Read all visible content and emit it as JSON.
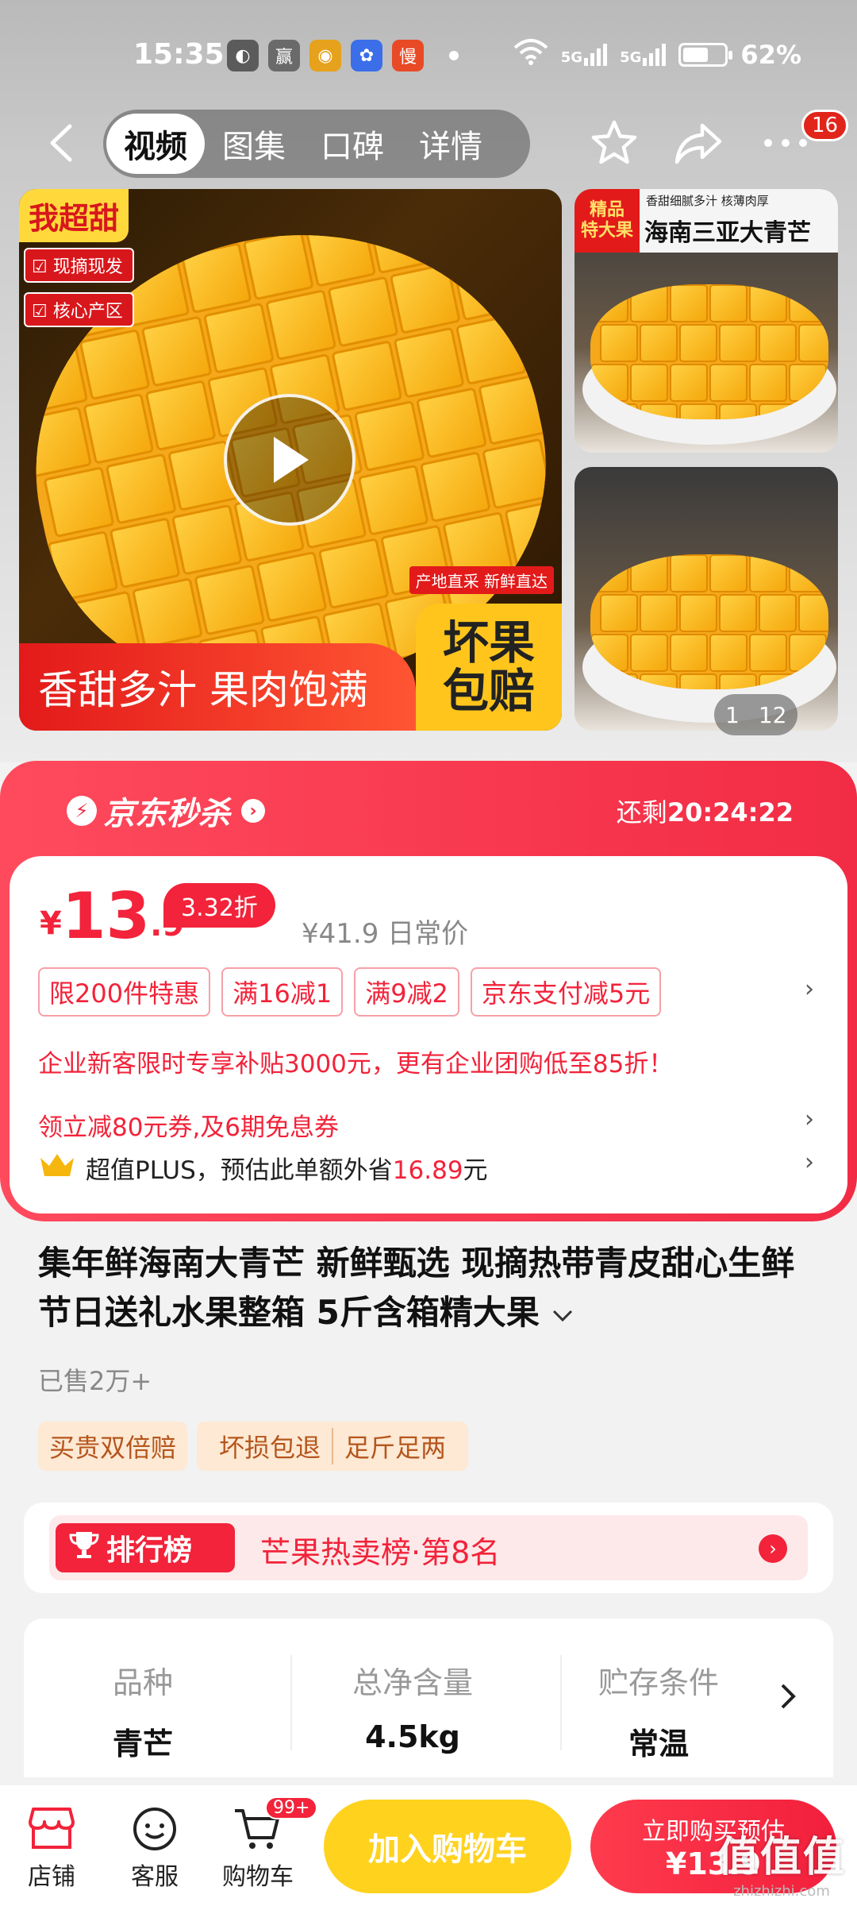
{
  "status": {
    "time": "15:35",
    "battery": "62%",
    "battery_level": 0.62,
    "net1": "5G",
    "net2": "5G"
  },
  "status_apps": [
    {
      "name": "wechat-icon",
      "glyph": "◐",
      "color": "#5b5b5b"
    },
    {
      "name": "realme-app-icon",
      "glyph": "赢",
      "color": "#6a6a6a"
    },
    {
      "name": "weibo-icon",
      "glyph": "◉",
      "color": "#e6a21c"
    },
    {
      "name": "baidu-icon",
      "glyph": "✿",
      "color": "#3b6ee8"
    },
    {
      "name": "slow-app-icon",
      "glyph": "慢",
      "color": "#e84a26"
    }
  ],
  "nav": {
    "tabs": [
      "视频",
      "图集",
      "口碑",
      "详情"
    ],
    "active_tab": 0,
    "more_badge": "16"
  },
  "media": {
    "main_tag": "我超甜",
    "chip1": "现摘现发",
    "chip2": "核心产区",
    "small_tag": "产地直采 新鲜直达",
    "bottom_text": "香甜多汁 果肉饱满",
    "side_badge_1": "坏果",
    "side_badge_2": "包赔",
    "thumb_tag_1": "精品",
    "thumb_tag_2": "特大果",
    "thumb_sub": "香甜细腻多汁  核薄肉厚",
    "thumb_title": "海南三亚大青芒",
    "counter_current": "1",
    "counter_total": "12"
  },
  "flash": {
    "title": "京东秒杀",
    "countdown_label": "还剩",
    "countdown": "20:24:22"
  },
  "price": {
    "yen": "¥",
    "int": "13",
    "dec": ".9",
    "discount": "3.32折",
    "original": "¥41.9 日常价",
    "promos": [
      "限200件特惠",
      "满16减1",
      "满9减2",
      "京东支付减5元"
    ],
    "enterprise": "企业新客限时专享补贴3000元，更有企业团购低至85折！",
    "coupon": "领立减80元券,及6期免息券",
    "plus_prefix": "超值PLUS，预估此单额外省",
    "plus_amount": "16.89",
    "plus_suffix": "元"
  },
  "product": {
    "title": "集年鲜海南大青芒 新鲜甄选 现摘热带青皮甜心生鲜节日送礼水果整箱 5斤含箱精大果",
    "sold": "已售2万+",
    "tag1": "买贵双倍赔",
    "tag2a": "坏损包退",
    "tag2b": "足斤足两"
  },
  "rank": {
    "badge": "排行榜",
    "text": "芒果热卖榜·第8名"
  },
  "specs": [
    {
      "k": "品种",
      "v": "青芒"
    },
    {
      "k": "总净含量",
      "v": "4.5kg"
    },
    {
      "k": "贮存条件",
      "v": "常温"
    }
  ],
  "bottom": {
    "store": "店铺",
    "service": "客服",
    "cart": "购物车",
    "cart_badge": "99+",
    "add_cart": "加入购物车",
    "buy_line1": "立即购买预估",
    "buy_line2": "¥13.9"
  },
  "watermark": {
    "big": "值值值",
    "small": "zhizhizhi.com"
  }
}
